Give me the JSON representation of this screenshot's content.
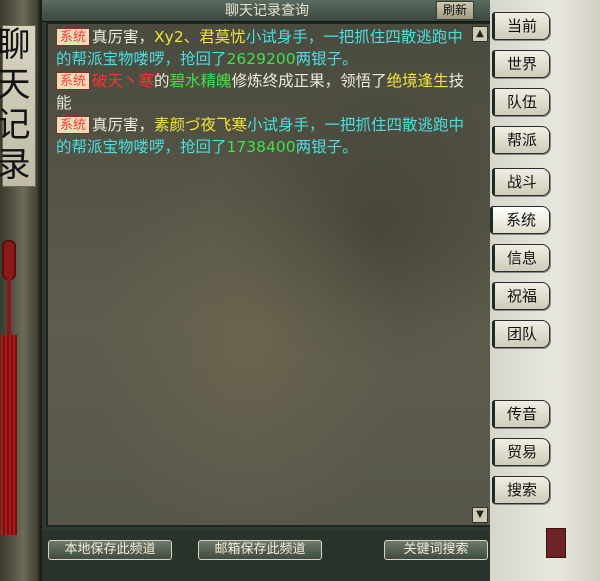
{
  "window": {
    "title": "聊天记录查询",
    "side_title": "聊天记录",
    "refresh_label": "刷新"
  },
  "messages": [
    {
      "tag": "系统",
      "segments": [
        {
          "text": "真厉害，",
          "color": "white"
        },
        {
          "text": "Xy2、君莫忧",
          "color": "yellow"
        },
        {
          "text": "小试身手，一把抓住四散逃跑中的",
          "color": "cyan"
        },
        {
          "text": "帮派宝物",
          "color": "cyan"
        },
        {
          "text": "喽啰，抢回了",
          "color": "cyan"
        },
        {
          "text": "2629200",
          "color": "green"
        },
        {
          "text": "两银子。",
          "color": "cyan"
        }
      ]
    },
    {
      "tag": "系统",
      "segments": [
        {
          "text": "破天丶寒",
          "color": "red"
        },
        {
          "text": "的",
          "color": "white"
        },
        {
          "text": "碧水精魄",
          "color": "green"
        },
        {
          "text": "修炼终成正果，领悟了",
          "color": "white"
        },
        {
          "text": "绝境逢生",
          "color": "yellow"
        },
        {
          "text": "技能",
          "color": "white"
        }
      ]
    },
    {
      "tag": "系统",
      "segments": [
        {
          "text": "真厉害，",
          "color": "white"
        },
        {
          "text": "素颜づ夜飞寒",
          "color": "yellow"
        },
        {
          "text": "小试身手，一把抓住四散逃跑中的",
          "color": "cyan"
        },
        {
          "text": "帮派宝物",
          "color": "cyan"
        },
        {
          "text": "喽啰，抢回了",
          "color": "cyan"
        },
        {
          "text": "1738400",
          "color": "green"
        },
        {
          "text": "两银子。",
          "color": "cyan"
        }
      ]
    }
  ],
  "tabs": [
    {
      "label": "当前",
      "active": false
    },
    {
      "label": "世界",
      "active": false
    },
    {
      "label": "队伍",
      "active": false
    },
    {
      "label": "帮派",
      "active": false
    },
    {
      "label": "战斗",
      "active": false
    },
    {
      "label": "系统",
      "active": true
    },
    {
      "label": "信息",
      "active": false
    },
    {
      "label": "祝福",
      "active": false
    },
    {
      "label": "团队",
      "active": false
    },
    {
      "label": "传音",
      "active": false
    },
    {
      "label": "贸易",
      "active": false
    },
    {
      "label": "搜索",
      "active": false
    }
  ],
  "bottom_buttons": {
    "save_local": "本地保存此频道",
    "mail_save": "邮箱保存此频道",
    "keyword_search": "关键词搜索"
  },
  "colors": {
    "white": "#ececdc",
    "yellow": "#f0e43a",
    "cyan": "#49e0e0",
    "green": "#3fe04a",
    "red": "#ff3030",
    "tag_text": "#ff3a3a"
  },
  "icons": {
    "scroll_up": "scroll-up-icon",
    "scroll_down": "scroll-down-icon"
  }
}
